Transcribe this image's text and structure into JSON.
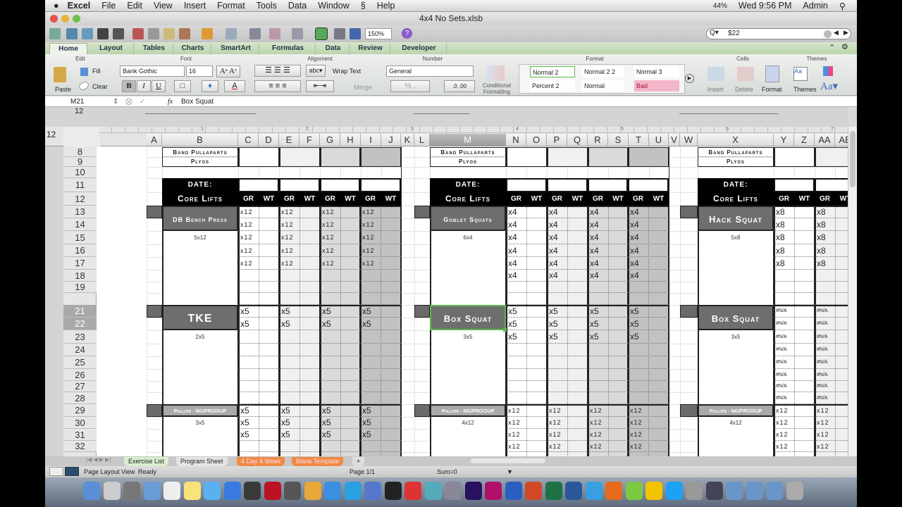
{
  "menubar": {
    "app": "Excel",
    "items": [
      "File",
      "Edit",
      "View",
      "Insert",
      "Format",
      "Tools",
      "Data",
      "Window",
      "Help"
    ],
    "battery": "44%",
    "clock": "Wed 9:56 PM",
    "user": "Admin"
  },
  "window": {
    "title": "4x4 No Sets.xlsb"
  },
  "toolbar": {
    "zoom": "150%",
    "search": "$22"
  },
  "ribbon": {
    "tabs": [
      "Home",
      "Layout",
      "Tables",
      "Charts",
      "SmartArt",
      "Formulas",
      "Data",
      "Review",
      "Developer"
    ],
    "groups": {
      "edit": "Edit",
      "font": "Font",
      "alignment": "Alignment",
      "number": "Number",
      "format": "Format",
      "cells": "Cells",
      "themes": "Themes"
    },
    "paste": "Paste",
    "fill": "Fill",
    "clear": "Clear",
    "font_name": "Bank Gothic",
    "font_size": "16",
    "bold": "B",
    "italic": "I",
    "underline": "U",
    "wrap_text": "Wrap Text",
    "merge": "Merge",
    "number_format": "General",
    "conditional": "Conditional Formatting",
    "styles": [
      "Normal 2",
      "Normal 2 2",
      "Normal 3",
      "Percent 2",
      "Normal",
      "Bad"
    ],
    "insert": "Insert",
    "delete": "Delete",
    "format_btn": "Format",
    "themes_btn": "Themes"
  },
  "formula": {
    "cell": "M21",
    "value": "Box Squat"
  },
  "ruler": [
    "1",
    "2",
    "3",
    "4",
    "5",
    "6",
    "7"
  ],
  "outline_levels": "12",
  "columns": [
    "A",
    "B",
    "C",
    "D",
    "E",
    "F",
    "G",
    "H",
    "I",
    "J",
    "K",
    "L",
    "M",
    "N",
    "O",
    "P",
    "Q",
    "R",
    "S",
    "T",
    "U",
    "V",
    "W",
    "X",
    "Y",
    "Z",
    "AA",
    "AB"
  ],
  "selected_column": "M",
  "rows": [
    "8",
    "9",
    "10",
    "11",
    "12",
    "13",
    "14",
    "15",
    "16",
    "17",
    "18",
    "19",
    "21",
    "22",
    "23",
    "24",
    "25",
    "26",
    "27",
    "28",
    "29",
    "30",
    "31",
    "32"
  ],
  "selected_rows": [
    "21",
    "22"
  ],
  "colors": {
    "dark_label": "#6e6e6e",
    "light_label": "#a9a9a9",
    "header": "#000000",
    "selection": "#5cb84a",
    "bad": "#f4b6c8"
  },
  "blocks": [
    {
      "top_rows": [
        "Band Pullaparts",
        "Plyos"
      ],
      "date_label": "DATE:",
      "core_label": "Core Lifts",
      "col_labels": [
        "GR",
        "WT",
        "GR",
        "WT",
        "GR",
        "WT",
        "GR",
        "WT"
      ],
      "exercises": [
        {
          "name": "DB Bench Press",
          "style": "dark",
          "small": true,
          "scheme": "5x12",
          "start": 13,
          "end": 20,
          "label_rows": 2,
          "values": [
            "x12",
            "x12",
            "x12",
            "x12",
            "x12"
          ]
        },
        {
          "name": "TKE",
          "style": "dark",
          "big": true,
          "scheme": "2x5",
          "start": 21,
          "end": 28,
          "label_rows": 2,
          "values": [
            "x5",
            "x5"
          ]
        },
        {
          "name": "Pullups - NG/PRO/SUP",
          "style": "light",
          "tiny": true,
          "scheme": "3x5",
          "start": 29,
          "end": 33,
          "label_rows": 1,
          "values": [
            "x5",
            "x5",
            "x5"
          ]
        }
      ]
    },
    {
      "top_rows": [
        "Band Pullaparts",
        "Plyos"
      ],
      "date_label": "DATE:",
      "core_label": "Core Lifts",
      "col_labels": [
        "GR",
        "WT",
        "GR",
        "WT",
        "GR",
        "WT",
        "GR",
        "WT"
      ],
      "exercises": [
        {
          "name": "Goblet Squats",
          "style": "dark",
          "small": true,
          "scheme": "6x4",
          "start": 13,
          "end": 20,
          "label_rows": 2,
          "values": [
            "x4",
            "x4",
            "x4",
            "x4",
            "x4",
            "x4"
          ]
        },
        {
          "name": "Box Squat",
          "style": "dark",
          "scheme": "3x5",
          "start": 21,
          "end": 28,
          "label_rows": 2,
          "values": [
            "x5",
            "x5",
            "x5"
          ],
          "selected": true
        },
        {
          "name": "Pullups - NG/PRO/SUP",
          "style": "light",
          "tiny": true,
          "scheme": "4x12",
          "start": 29,
          "end": 33,
          "label_rows": 1,
          "values": [
            "x12",
            "x12",
            "x12",
            "x12"
          ]
        }
      ]
    },
    {
      "top_rows": [
        "Band Pullaparts",
        "Plyos"
      ],
      "date_label": "DATE:",
      "core_label": "Core Lifts",
      "col_labels": [
        "GR",
        "WT",
        "GR",
        "WT",
        "GR",
        "WT",
        "GR",
        "WT"
      ],
      "exercises": [
        {
          "name": "Hack Squat",
          "style": "dark",
          "scheme": "5x8",
          "start": 13,
          "end": 20,
          "label_rows": 2,
          "values": [
            "x8",
            "x8",
            "x8",
            "x8",
            "x8"
          ]
        },
        {
          "name": "Box Squat",
          "style": "dark",
          "scheme": "3x5",
          "start": 21,
          "end": 28,
          "label_rows": 2,
          "values": [
            "#N/A",
            "#N/A",
            "#N/A",
            "#N/A",
            "#N/A",
            "#N/A",
            "#N/A",
            "#N/A"
          ]
        },
        {
          "name": "Pullups - NG/PRO/SUP",
          "style": "light",
          "tiny": true,
          "scheme": "4x12",
          "start": 29,
          "end": 33,
          "label_rows": 1,
          "values": [
            "x12",
            "x12",
            "x12",
            "x12"
          ]
        }
      ]
    }
  ],
  "sheet_tabs": [
    {
      "label": "Exercise List",
      "color": "#d9efcf"
    },
    {
      "label": "Program Sheet",
      "color": "#e4e4e4"
    },
    {
      "label": "4 Day 4 Week",
      "color": "#ef8a45"
    },
    {
      "label": "Blank Template",
      "color": "#ef8a45"
    }
  ],
  "add_sheet": "+",
  "status": {
    "view": "Page Layout View",
    "ready": "Ready",
    "page": "Page 1/1",
    "sum": "Sum=0"
  },
  "dock": [
    "finder",
    "launchpad",
    "mission-control",
    "preview",
    "textedit",
    "notes",
    "messages",
    "itunes",
    "facetime",
    "photo-booth",
    "imovie",
    "garageband",
    "app-store",
    "skype",
    "keynote",
    "dvd-player",
    "ical",
    "mail",
    "image-capture",
    "after-effects",
    "indesign",
    "photoshop",
    "powerpoint",
    "excel",
    "word",
    "safari",
    "firefox",
    "evernote",
    "omnifocus",
    "twitter",
    "system-preferences",
    "quicktime",
    "downloads-folder",
    "documents-folder",
    "applications-folder",
    "trash"
  ]
}
